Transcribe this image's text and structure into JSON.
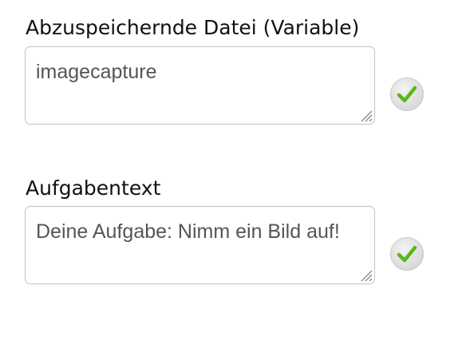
{
  "fields": [
    {
      "label": "Abzuspeichernde Datei (Variable)",
      "value": "imagecapture",
      "confirm_icon": "check-icon"
    },
    {
      "label": "Aufgabentext",
      "value": "Deine Aufgabe: Nimm ein Bild auf!",
      "confirm_icon": "check-icon"
    }
  ],
  "colors": {
    "check_green": "#58b81c",
    "border": "#c4c4c4",
    "text": "#555555"
  }
}
